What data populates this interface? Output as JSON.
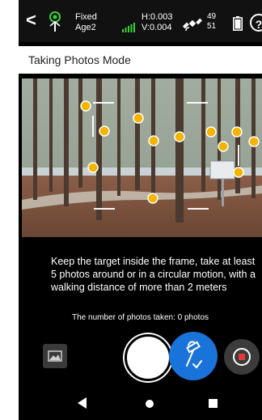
{
  "status": {
    "fix_status": "Fixed",
    "age": "Age2",
    "h_precision": "H:0.003",
    "v_precision": "V:0.004",
    "satellites_used": "49",
    "satellites_tracked": "51",
    "help_glyph": "?"
  },
  "header": {
    "back_glyph": "<",
    "title": "Taking Photos Mode"
  },
  "instructions": {
    "text": "Keep the target inside the frame, take at least 5 photos around or in a circular motion, with a walking distance of more than 2 meters"
  },
  "photo_count": {
    "text": "The number of photos taken: 0 photos"
  },
  "feature_points": {
    "count": 13,
    "color": "#f5b400"
  },
  "icons": {
    "gnss": "gnss-antenna-icon",
    "signal": "signal-bars-icon",
    "satellite": "satellite-icon",
    "battery": "battery-icon",
    "help": "help-icon",
    "gallery": "gallery-icon",
    "rtk": "rtk-pole-check-icon",
    "record": "record-icon",
    "nav_back": "nav-back-icon",
    "nav_home": "nav-home-icon",
    "nav_recent": "nav-recent-icon"
  },
  "colors": {
    "accent_blue": "#1a73d9",
    "signal_green": "#3ccf3c",
    "record_red": "#e53935",
    "point_yellow": "#f5b400"
  }
}
